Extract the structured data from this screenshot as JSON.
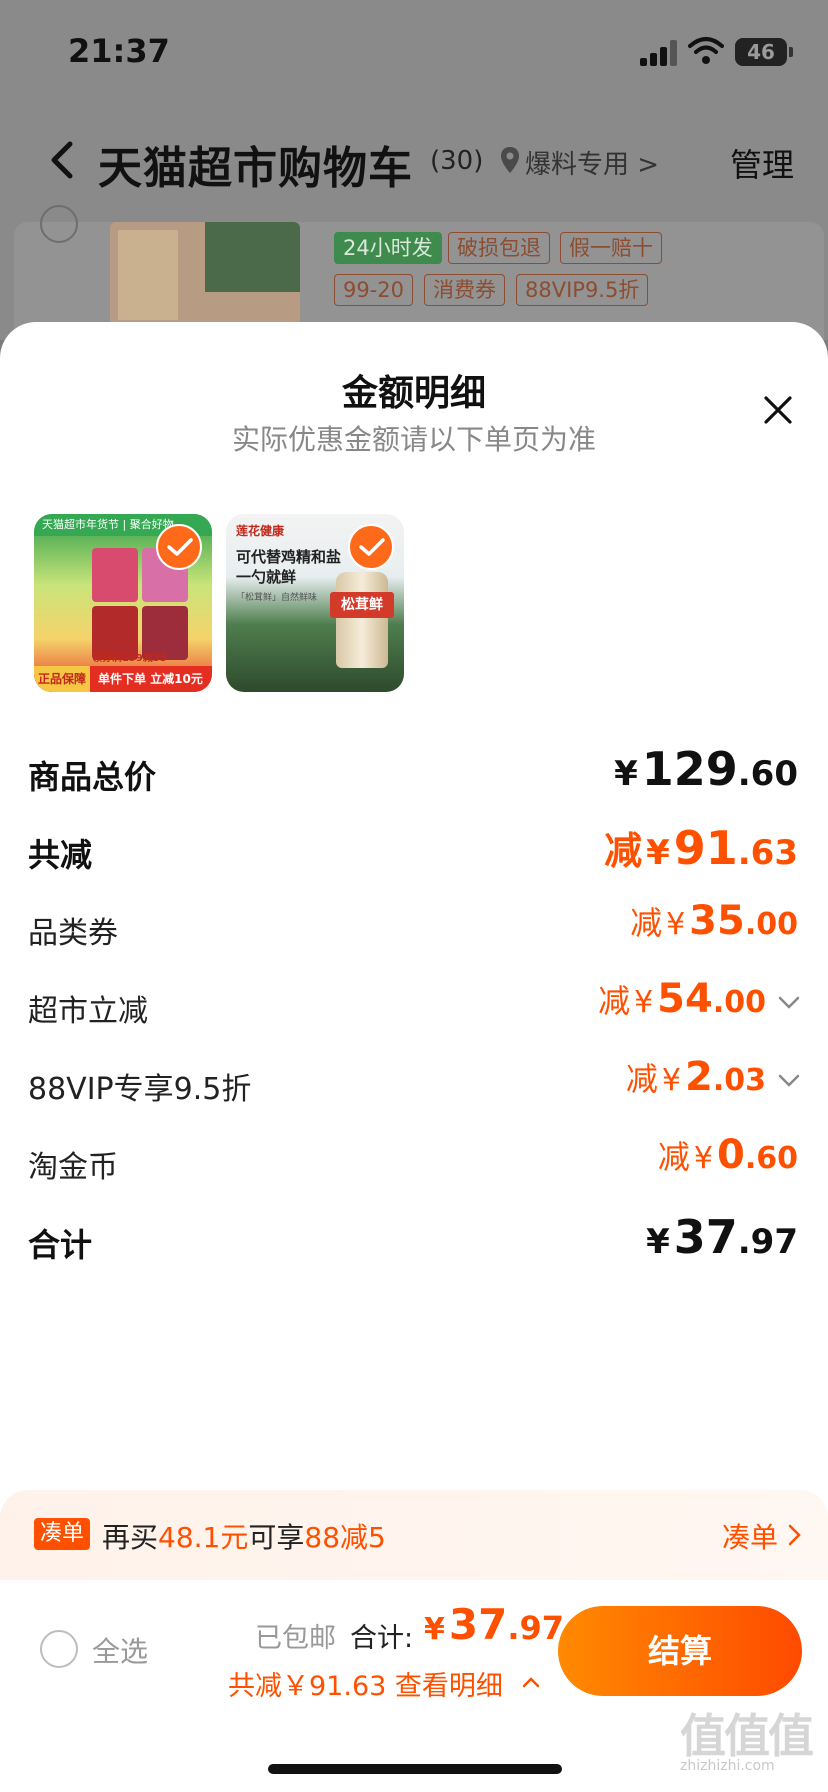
{
  "status_bar": {
    "time": "21:37",
    "battery": "46"
  },
  "nav": {
    "title": "天猫超市购物车",
    "count": "(30)",
    "location": "爆料专用",
    "location_chevron": ">",
    "manage": "管理"
  },
  "background_item": {
    "tags": [
      "24小时发",
      "破损包退",
      "假一赔十",
      "99-20",
      "消费券",
      "88VIP9.5折"
    ]
  },
  "sheet": {
    "title": "金额明细",
    "subtitle": "实际优惠金额请以下单页为准"
  },
  "products": [
    {
      "top_text": "天猫超市年货节 | 聚合好物",
      "coupon_text": "领券满199减35",
      "badge": "正品保障",
      "promo": "单件下单 立减10元"
    },
    {
      "brand": "莲花健康",
      "line1": "可代替鸡精和盐",
      "line2": "一勺就鲜",
      "line3": "「松茸鲜」自然鲜味",
      "jar_label": "松茸鲜"
    }
  ],
  "breakdown": [
    {
      "label": "商品总价",
      "prefix": "",
      "yen": "¥",
      "int": "129",
      "dec": ".60",
      "color": "#111111",
      "bold": true
    },
    {
      "label": "共减",
      "prefix": "减",
      "yen": "¥",
      "int": "91",
      "dec": ".63",
      "color": "#ff5000",
      "bold": true
    },
    {
      "label": "品类券",
      "prefix": "减",
      "yen": "¥",
      "int": "35",
      "dec": ".00",
      "color": "#ff5000",
      "bold": false
    },
    {
      "label": "超市立减",
      "prefix": "减",
      "yen": "¥",
      "int": "54",
      "dec": ".00",
      "color": "#ff5000",
      "bold": false,
      "expandable": true
    },
    {
      "label": "88VIP专享9.5折",
      "prefix": "减",
      "yen": "¥",
      "int": "2",
      "dec": ".03",
      "color": "#ff5000",
      "bold": false,
      "expandable": true
    },
    {
      "label": "淘金币",
      "prefix": "减",
      "yen": "¥",
      "int": "0",
      "dec": ".60",
      "color": "#ff5000",
      "bold": false
    },
    {
      "label": "合计",
      "prefix": "",
      "yen": "¥",
      "int": "37",
      "dec": ".97",
      "color": "#111111",
      "bold": true
    }
  ],
  "promo_bar": {
    "badge": "凑单",
    "text_a": "再买",
    "text_b": "48.1元",
    "text_c": "可享",
    "text_d": "88减5",
    "link": "凑单"
  },
  "bottom_bar": {
    "select_all": "全选",
    "shipping": "已包邮",
    "total_label": "合计:",
    "total_yen": "¥",
    "total_int": "37",
    "total_dec": ".97",
    "discount": "共减￥91.63  查看明细",
    "checkout": "结算"
  },
  "watermark": {
    "main": "值值值",
    "sub": "zhizhizhi.com"
  },
  "colors": {
    "accent": "#ff5000",
    "button_start": "#ff8a00",
    "button_end": "#ff4a00"
  }
}
